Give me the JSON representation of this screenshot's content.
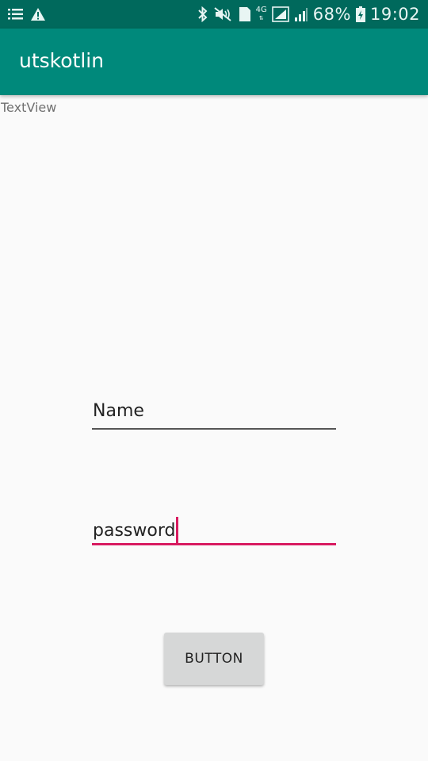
{
  "status_bar": {
    "battery_percent": "68%",
    "time": "19:02",
    "network": "4G",
    "sim": "1",
    "icons": [
      "menu-icon",
      "warning-icon",
      "bluetooth-icon",
      "mute-icon",
      "sim-icon",
      "signal-icon",
      "battery-icon"
    ]
  },
  "app_bar": {
    "title": "utskotlin",
    "color": "#00897b"
  },
  "content": {
    "textview_label": "TextView",
    "name_field": {
      "value": "Name"
    },
    "password_field": {
      "value": "password"
    },
    "button_label": "BUTTON"
  },
  "colors": {
    "status_bar": "#00695c",
    "app_bar": "#00897b",
    "accent": "#d81b60",
    "background": "#fafafa"
  }
}
